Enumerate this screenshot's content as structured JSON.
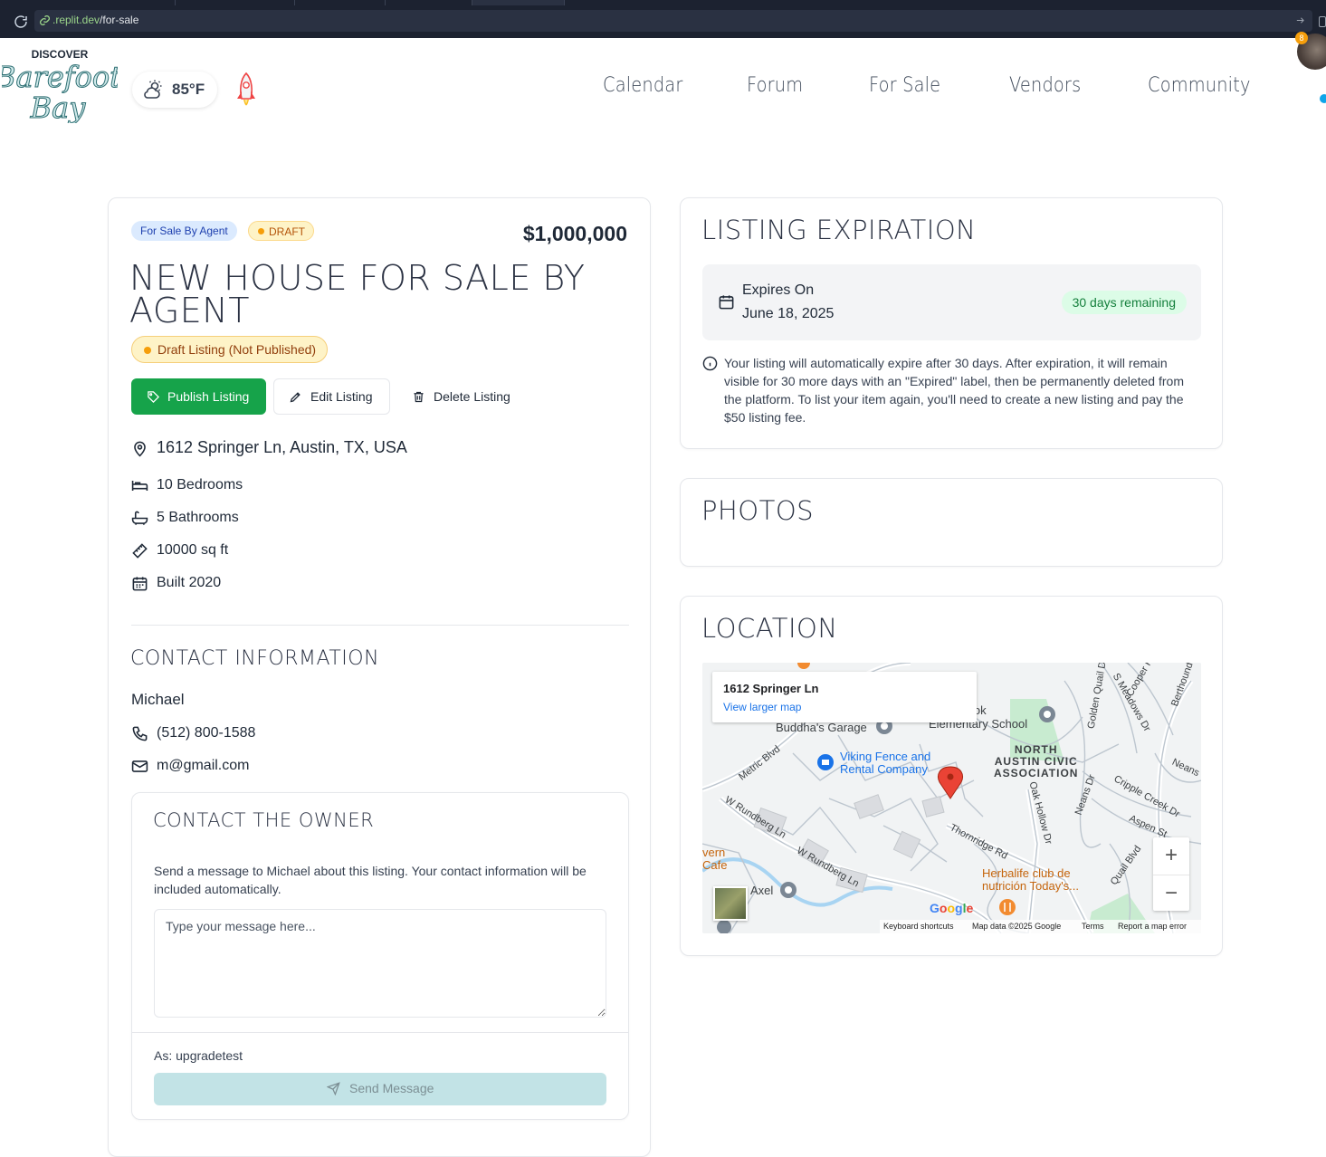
{
  "browser": {
    "url_host": ".replit.dev",
    "url_path": "/for-sale"
  },
  "header": {
    "logo_top": "DISCOVER",
    "logo_line1": "Barefoot",
    "logo_line2": "Bay",
    "weather_temp": "85°F",
    "nav": [
      "Calendar",
      "Forum",
      "For Sale",
      "Vendors",
      "Community"
    ],
    "avatar_badge": "8"
  },
  "listing": {
    "badge_type": "For Sale By Agent",
    "badge_status": "DRAFT",
    "price": "$1,000,000",
    "title": "NEW HOUSE FOR SALE BY AGENT",
    "status_pill": "Draft Listing (Not Published)",
    "publish_label": "Publish Listing",
    "edit_label": "Edit Listing",
    "delete_label": "Delete Listing",
    "address": "1612 Springer Ln, Austin, TX, USA",
    "bedrooms": "10 Bedrooms",
    "bathrooms": "5 Bathrooms",
    "sqft": "10000 sq ft",
    "built": "Built 2020"
  },
  "contact": {
    "heading": "CONTACT INFORMATION",
    "name": "Michael",
    "phone": "(512) 800-1588",
    "email": "m@gmail.com"
  },
  "owner": {
    "heading": "CONTACT THE OWNER",
    "description": "Send a message to Michael about this listing. Your contact information will be included automatically.",
    "placeholder": "Type your message here...",
    "as_user": "As: upgradetest",
    "send_label": "Send Message"
  },
  "expiration": {
    "heading": "LISTING EXPIRATION",
    "label": "Expires On",
    "date": "June 18, 2025",
    "remaining": "30 days remaining",
    "note": "Your listing will automatically expire after 30 days. After expiration, it will remain visible for 30 more days with an \"Expired\" label, then be permanently deleted from the platform. To list your item again, you'll need to create a new listing and pay the $50 listing fee."
  },
  "photos": {
    "heading": "PHOTOS"
  },
  "location": {
    "heading": "LOCATION",
    "info_title": "1612 Springer Ln",
    "info_link": "View larger map",
    "labels": {
      "school": "he A. Cook\nElementary School",
      "buddhas": "Buddha's Garage",
      "viking": "Viking Fence and\nRental Company",
      "north_austin": "NORTH\nAUSTIN CIVIC\nASSOCIATION",
      "herbalife": "Herbalife club de\nnutrición Today's...",
      "axel": "Axel",
      "tavern": "vern\nCafe"
    },
    "streets": {
      "metric": "Metric Blvd",
      "rundberg1": "W Rundberg Ln",
      "rundberg2": "W Rundberg Ln",
      "thornridge": "Thornridge Rd",
      "oak_hollow": "Oak Hollow Dr",
      "neans": "Neans Dr",
      "cripple": "Cripple Creek Dr",
      "aspen": "Aspen St",
      "quail": "Quail Blvd",
      "golden": "Golden Quail Dr",
      "meadows": "S Meadows Dr",
      "cooper": "Cooper R",
      "berthound": "Berthound",
      "neans2": "Neans"
    },
    "google": "Google",
    "footer": [
      "Keyboard shortcuts",
      "Map data ©2025 Google",
      "Terms",
      "Report a map error"
    ],
    "zoom_in": "+",
    "zoom_out": "−"
  }
}
